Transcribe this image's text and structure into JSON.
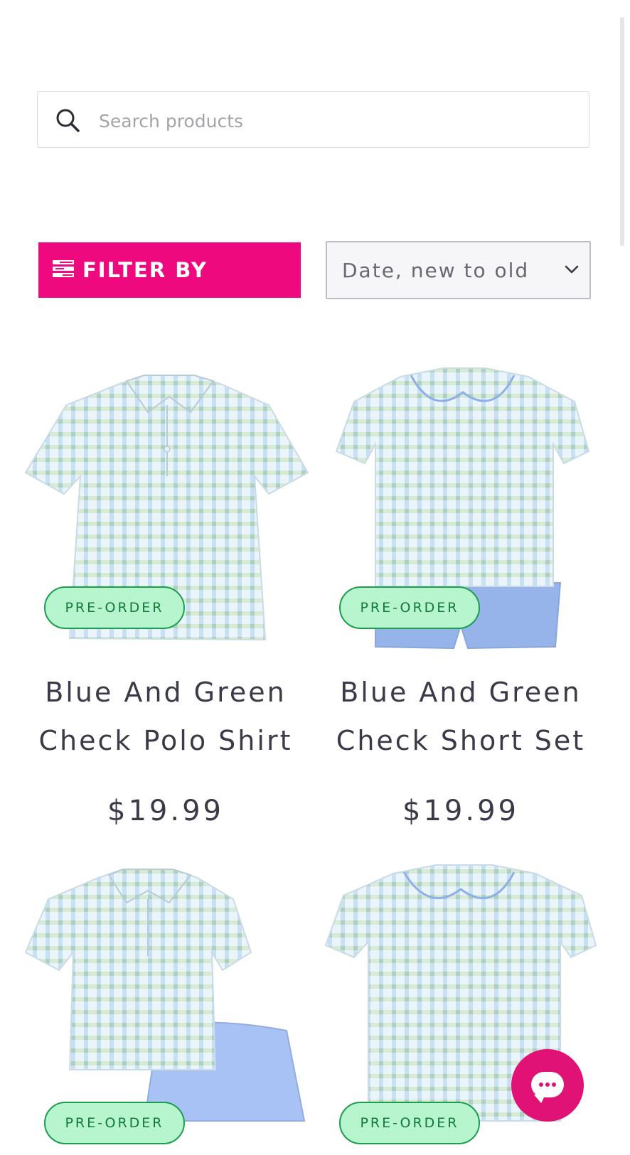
{
  "search": {
    "placeholder": "Search products"
  },
  "toolbar": {
    "filter_label": "FILTER BY",
    "sort_value": "Date, new to old"
  },
  "products": [
    {
      "title_line1": "Blue And Green",
      "title_line2": "Check Polo Shirt",
      "price": "$19.99",
      "badge": "PRE-ORDER"
    },
    {
      "title_line1": "Blue And Green",
      "title_line2": "Check Short Set",
      "price": "$19.99",
      "badge": "PRE-ORDER"
    },
    {
      "badge": "PRE-ORDER"
    },
    {
      "badge": "PRE-ORDER"
    }
  ],
  "colors": {
    "accent": "#ee0a7e",
    "badge_bg": "#b7f5cf",
    "badge_border": "#1c9e4d",
    "chat": "#e11276"
  },
  "icons": [
    "search-icon",
    "filter-icon",
    "chevron-down-icon",
    "chat-icon"
  ]
}
